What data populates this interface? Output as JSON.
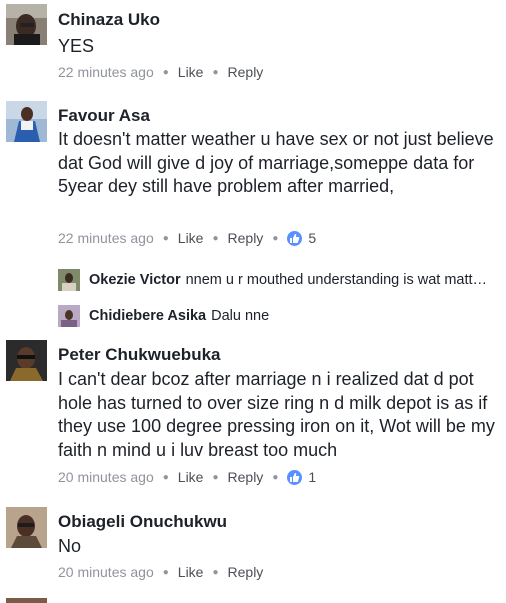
{
  "comments": [
    {
      "name": "Chinaza Uko",
      "text": "YES",
      "time": "22 minutes ago",
      "like_label": "Like",
      "reply_label": "Reply"
    },
    {
      "name": "Favour Asa",
      "text": "It doesn't matter weather u have sex or not just believe dat God will give d joy of marriage,someppe data for 5year dey still have problem after married,",
      "time": "22 minutes ago",
      "like_label": "Like",
      "reply_label": "Reply",
      "reaction_count": "5",
      "replies": [
        {
          "name": "Okezie Victor",
          "text": "nnem u r mouthed understanding is wat matt…"
        },
        {
          "name": "Chidiebere Asika",
          "text": "Dalu nne"
        }
      ]
    },
    {
      "name": "Peter Chukwuebuka",
      "text": "I can't dear bcoz after marriage n i realized dat d pot hole has turned to over size ring n d milk depot is as if they use 100 degree pressing iron on it, Wot will be my faith n mind u i luv breast too much",
      "time": "20 minutes ago",
      "like_label": "Like",
      "reply_label": "Reply",
      "reaction_count": "1"
    },
    {
      "name": "Obiageli Onuchukwu",
      "text": "No",
      "time": "20 minutes ago",
      "like_label": "Like",
      "reply_label": "Reply"
    }
  ],
  "colors": {
    "like_badge": "#5890ff",
    "meta_text": "#90949c",
    "name_text": "#1d2129"
  },
  "icons": {
    "reaction": "thumbs-up-icon"
  }
}
